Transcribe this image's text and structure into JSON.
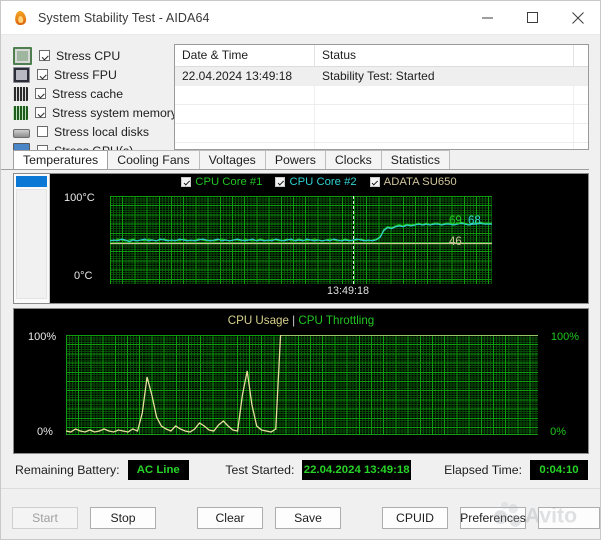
{
  "window": {
    "title": "System Stability Test - AIDA64",
    "icon": "flame-icon",
    "minimize": "minimize",
    "maximize": "maximize",
    "close": "close"
  },
  "stress_options": [
    {
      "label": "Stress CPU",
      "checked": true,
      "icon": "cpu-icon"
    },
    {
      "label": "Stress FPU",
      "checked": true,
      "icon": "fpu-icon"
    },
    {
      "label": "Stress cache",
      "checked": true,
      "icon": "cache-icon"
    },
    {
      "label": "Stress system memory",
      "checked": true,
      "icon": "memory-icon"
    },
    {
      "label": "Stress local disks",
      "checked": false,
      "icon": "disk-icon"
    },
    {
      "label": "Stress GPU(s)",
      "checked": false,
      "icon": "gpu-icon"
    }
  ],
  "log": {
    "columns": [
      "Date & Time",
      "Status",
      ""
    ],
    "rows": [
      {
        "datetime": "22.04.2024 13:49:18",
        "status": "Stability Test: Started",
        "extra": ""
      }
    ]
  },
  "tabs": [
    {
      "label": "Temperatures",
      "active": true
    },
    {
      "label": "Cooling Fans",
      "active": false
    },
    {
      "label": "Voltages",
      "active": false
    },
    {
      "label": "Powers",
      "active": false
    },
    {
      "label": "Clocks",
      "active": false
    },
    {
      "label": "Statistics",
      "active": false
    }
  ],
  "chart_data": [
    {
      "type": "line",
      "name": "temperatures",
      "title": "",
      "ylabel_top": "100°C",
      "ylabel_bottom": "0°C",
      "ylim": [
        0,
        100
      ],
      "grid": true,
      "legend_position": "top-center",
      "annotation_time": "13:49:18",
      "legend": [
        {
          "label": "CPU Core #1",
          "color": "#22c422",
          "checked": true
        },
        {
          "label": "CPU Core #2",
          "color": "#2fd0d0",
          "checked": true
        },
        {
          "label": "ADATA SU650",
          "color": "#cfc49a",
          "checked": true
        }
      ],
      "current_values": [
        {
          "label": "69",
          "color": "#22c422"
        },
        {
          "label": "68",
          "color": "#2fd0d0"
        },
        {
          "label": "46",
          "color": "#cfc49a"
        }
      ],
      "series": [
        {
          "name": "CPU Core #1",
          "color": "#22c422",
          "values": [
            50,
            49,
            51,
            50,
            49,
            50,
            51,
            49,
            50,
            49,
            51,
            50,
            49,
            50,
            51,
            50,
            49,
            50,
            49,
            51,
            50,
            49,
            50,
            51,
            50,
            49,
            50,
            49,
            50,
            51,
            50,
            49,
            50,
            50,
            49,
            51,
            50,
            49,
            50,
            51,
            50,
            49,
            51,
            50,
            49,
            50,
            51,
            49,
            50,
            51,
            50,
            49,
            50,
            51,
            50,
            49,
            50,
            51,
            50,
            49,
            50,
            51,
            50,
            49,
            50,
            51,
            50,
            49,
            50,
            51,
            54,
            62,
            65,
            64,
            66,
            67,
            66,
            68,
            67,
            68,
            69,
            68,
            69,
            68,
            69,
            69,
            68,
            69,
            69,
            68,
            69,
            70,
            69,
            68,
            69,
            69,
            70,
            69,
            69,
            69
          ]
        },
        {
          "name": "CPU Core #2",
          "color": "#2fd0d0",
          "values": [
            49,
            50,
            49,
            51,
            50,
            48,
            50,
            49,
            50,
            51,
            49,
            50,
            49,
            51,
            50,
            49,
            50,
            49,
            51,
            50,
            49,
            50,
            49,
            50,
            51,
            50,
            49,
            50,
            51,
            49,
            50,
            49,
            50,
            51,
            50,
            49,
            50,
            51,
            49,
            50,
            49,
            50,
            49,
            51,
            50,
            49,
            50,
            51,
            49,
            50,
            49,
            51,
            50,
            49,
            50,
            49,
            50,
            49,
            51,
            50,
            49,
            50,
            49,
            50,
            51,
            50,
            49,
            50,
            49,
            50,
            53,
            61,
            64,
            63,
            65,
            66,
            65,
            67,
            66,
            67,
            68,
            67,
            68,
            67,
            68,
            68,
            67,
            68,
            68,
            67,
            68,
            69,
            68,
            67,
            68,
            68,
            69,
            68,
            68,
            68
          ]
        },
        {
          "name": "ADATA SU650",
          "color": "#cfc49a",
          "values": [
            46,
            46,
            46,
            46,
            46,
            46,
            46,
            46,
            46,
            46,
            46,
            46,
            46,
            46,
            46,
            46,
            46,
            46,
            46,
            46,
            46,
            46,
            46,
            46,
            46,
            46,
            46,
            46,
            46,
            46,
            46,
            46,
            46,
            46,
            46,
            46,
            46,
            46,
            46,
            46,
            46,
            46,
            46,
            46,
            46,
            46,
            46,
            46,
            46,
            46,
            46,
            46,
            46,
            46,
            46,
            46,
            46,
            46,
            46,
            46,
            46,
            46,
            46,
            46,
            46,
            46,
            46,
            46,
            46,
            46,
            46,
            46,
            46,
            46,
            46,
            46,
            46,
            46,
            46,
            46,
            46,
            46,
            46,
            46,
            46,
            46,
            46,
            46,
            46,
            46,
            46,
            46,
            46,
            46,
            46,
            46,
            46,
            46,
            46,
            46
          ]
        }
      ]
    },
    {
      "type": "line",
      "name": "cpu-usage",
      "title_parts": [
        {
          "text": "CPU Usage",
          "color": "#d7d18a"
        },
        {
          "text": " | ",
          "color": "#d0d0d0"
        },
        {
          "text": "CPU Throttling",
          "color": "#22c422"
        }
      ],
      "ylabel_top_left": "100%",
      "ylabel_bottom_left": "0%",
      "ylabel_top_right": "100%",
      "ylabel_bottom_right": "0%",
      "ylim": [
        0,
        100
      ],
      "grid": true,
      "series": [
        {
          "name": "CPU Usage",
          "color": "#e5df9a",
          "values": [
            4,
            3,
            6,
            4,
            3,
            5,
            3,
            4,
            6,
            4,
            3,
            5,
            4,
            3,
            6,
            4,
            22,
            58,
            40,
            18,
            9,
            6,
            4,
            9,
            6,
            4,
            3,
            6,
            12,
            9,
            5,
            4,
            10,
            14,
            9,
            5,
            4,
            40,
            64,
            30,
            9,
            5,
            4,
            3,
            6,
            100,
            100,
            100,
            100,
            100,
            100,
            100,
            100,
            100,
            100,
            100,
            100,
            100,
            100,
            100,
            100,
            100,
            100,
            100,
            100,
            100,
            100,
            100,
            100,
            100,
            100,
            100,
            100,
            100,
            100,
            100,
            100,
            100,
            100,
            100,
            100,
            100,
            100,
            100,
            100,
            100,
            100,
            100,
            100,
            100,
            100,
            100,
            100,
            100,
            100,
            100,
            100,
            100,
            100,
            100
          ]
        },
        {
          "name": "CPU Throttling",
          "color": "#18b418",
          "values": [
            0,
            0,
            0,
            0,
            0,
            0,
            0,
            0,
            0,
            0,
            0,
            0,
            0,
            0,
            0,
            0,
            0,
            0,
            0,
            0,
            0,
            0,
            0,
            0,
            0,
            0,
            0,
            0,
            0,
            0,
            0,
            0,
            0,
            0,
            0,
            0,
            0,
            0,
            0,
            0,
            0,
            0,
            0,
            0,
            0,
            0,
            0,
            0,
            0,
            0,
            0,
            0,
            0,
            0,
            0,
            0,
            0,
            0,
            0,
            0,
            0,
            0,
            0,
            0,
            0,
            0,
            0,
            0,
            0,
            0,
            0,
            0,
            0,
            0,
            0,
            0,
            0,
            0,
            0,
            0,
            0,
            0,
            0,
            0,
            0,
            0,
            0,
            0,
            0,
            0,
            0,
            0,
            0,
            0,
            0,
            0,
            0,
            0,
            0,
            0
          ]
        }
      ]
    }
  ],
  "status": {
    "battery_label": "Remaining Battery:",
    "battery_value": "AC Line",
    "started_label": "Test Started:",
    "started_value": "22.04.2024 13:49:18",
    "elapsed_label": "Elapsed Time:",
    "elapsed_value": "0:04:10",
    "value_color": "#27d427"
  },
  "buttons": [
    {
      "label": "Start",
      "disabled": true
    },
    {
      "label": "Stop",
      "disabled": false
    },
    {
      "label": "Clear",
      "disabled": false
    },
    {
      "label": "Save",
      "disabled": false
    },
    {
      "label": "CPUID",
      "disabled": false
    },
    {
      "label": "Preferences",
      "disabled": false
    }
  ],
  "watermark": {
    "text": "Avito"
  }
}
